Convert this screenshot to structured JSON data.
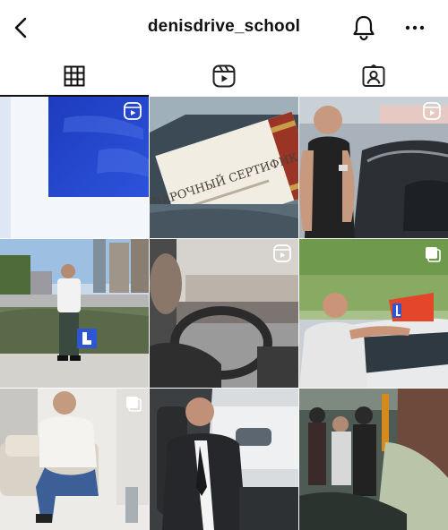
{
  "profile": {
    "username": "denisdrive_school"
  },
  "icons": {
    "back": "chevron-left-icon",
    "bell": "bell-icon",
    "more": "more-horizontal-icon",
    "grid": "grid-icon",
    "reels": "reels-icon",
    "tagged": "tagged-icon"
  },
  "colors": {
    "text": "#111111",
    "accent_blue": "#1f46d8",
    "learner_red": "#e01b1b"
  },
  "posts": [
    {
      "name": "learner-plate-L",
      "badge": "reel"
    },
    {
      "name": "gift-certificate",
      "badge": "none",
      "text": "ПОДАРОЧНЫЙ СЕРТИФИКАТ"
    },
    {
      "name": "instructor-black-shirt",
      "badge": "reel"
    },
    {
      "name": "instructor-city-plaza",
      "badge": "none"
    },
    {
      "name": "car-interior-steering",
      "badge": "reel"
    },
    {
      "name": "instructor-car-learner-sign",
      "badge": "multi"
    },
    {
      "name": "instructor-sofa",
      "badge": "multi"
    },
    {
      "name": "instructor-driver-seat",
      "badge": "none"
    },
    {
      "name": "crowded-bus",
      "badge": "none"
    }
  ]
}
